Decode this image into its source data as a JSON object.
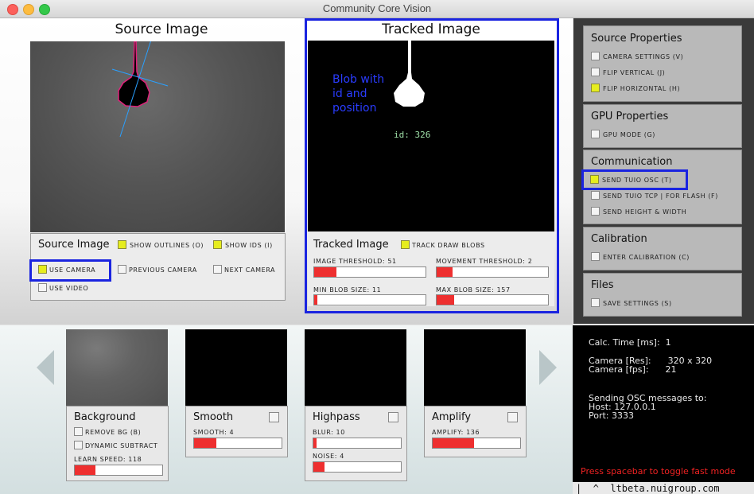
{
  "window": {
    "title": "Community Core Vision"
  },
  "source_panel": {
    "title": "Source Image",
    "label": "Source Image",
    "show_outlines": "Show Outlines (O)",
    "show_ids": "Show IDs (I)",
    "use_camera": "Use Camera",
    "previous_camera": "Previous Camera",
    "next_camera": "Next Camera",
    "use_video": "Use Video",
    "checked": {
      "show_outlines": true,
      "show_ids": true,
      "use_camera": true,
      "use_video": false
    }
  },
  "tracked_panel": {
    "title": "Tracked Image",
    "label": "Tracked Image",
    "overlay_line1": "Blob with",
    "overlay_line2": "id and",
    "overlay_line3": "position",
    "blob_id": "id: 326",
    "track_draw_blobs": "Track Draw Blobs",
    "image_threshold": "Image Threshold: 51",
    "movement_threshold": "Movement Threshold: 2",
    "min_blob_size": "Min Blob Size: 11",
    "max_blob_size": "Max Blob Size: 157",
    "levels": {
      "image_threshold": 0.2,
      "movement_threshold": 0.14,
      "min_blob_size": 0.03,
      "max_blob_size": 0.16
    }
  },
  "right_panel": {
    "source_properties": {
      "title": "Source Properties",
      "camera_settings": "Camera Settings (V)",
      "flip_vertical": "Flip Vertical (J)",
      "flip_horizontal": "Flip Horizontal (H)"
    },
    "gpu_properties": {
      "title": "GPU Properties",
      "gpu_mode": "GPU Mode (G)"
    },
    "communication": {
      "title": "Communication",
      "send_tuio_osc": "Send TUIO OSC (T)",
      "send_tuio_tcp": "Send TUIO TCP | For Flash (F)",
      "send_height_width": "Send Height & Width"
    },
    "calibration": {
      "title": "Calibration",
      "enter_calibration": "Enter Calibration (C)"
    },
    "files": {
      "title": "Files",
      "save_settings": "Save Settings (S)"
    }
  },
  "filters": {
    "background": {
      "title": "Background",
      "remove_bg": "Remove BG (B)",
      "dynamic_subtract": "Dynamic Subtract",
      "learn_speed": "Learn Speed: 118",
      "level": 0.24
    },
    "smooth": {
      "title": "Smooth",
      "smooth": "Smooth: 4",
      "level": 0.25
    },
    "highpass": {
      "title": "Highpass",
      "blur": "Blur: 10",
      "blur_level": 0.04,
      "noise": "Noise: 4",
      "noise_level": 0.13
    },
    "amplify": {
      "title": "Amplify",
      "amplify": "Amplify: 136",
      "level": 0.47
    }
  },
  "info": {
    "calc_time": "Calc. Time [ms]:  1",
    "camera_res": "Camera [Res]:      320 x 320",
    "camera_fps": "Camera [fps]:      21",
    "osc_heading": "Sending OSC messages to:",
    "host": "Host: 127.0.0.1",
    "port": "Port: 3333",
    "hint": "Press spacebar to toggle fast mode",
    "footer": "|  ^  ltbeta.nuigroup.com"
  },
  "colors": {
    "accent_blue": "#1a24e0",
    "slider_fill": "#ee2f2f",
    "checkbox_on": "#e6ed1e",
    "hint_red": "#ee2222"
  }
}
